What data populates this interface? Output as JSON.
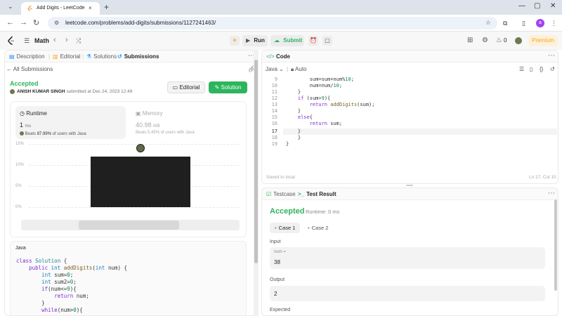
{
  "browser": {
    "tab_title": "Add Digits - LeetCode",
    "tab_close": "×",
    "new_tab": "+",
    "url": "leetcode.com/problems/add-digits/submissions/1127241463/"
  },
  "header": {
    "problem_list": "Math",
    "run_label": "Run",
    "submit_label": "Submit",
    "coins": "0",
    "premium_label": "Premium"
  },
  "left_tabs": [
    {
      "label": "Description"
    },
    {
      "label": "Editorial"
    },
    {
      "label": "Solutions"
    },
    {
      "label": "Submissions"
    }
  ],
  "submission": {
    "back_label": "All Submissions",
    "status": "Accepted",
    "author": "ANISH KUMAR SINGH",
    "submitted_text": "submitted at Dec 24, 2023 12:49",
    "editorial_btn": "Editorial",
    "solution_btn": "Solution"
  },
  "runtime": {
    "label": "Runtime",
    "value": "1",
    "unit": "ms",
    "beats_prefix": "Beats ",
    "beats_pct": "87.99%",
    "beats_suffix": " of users with Java"
  },
  "memory": {
    "label": "Memory",
    "value": "40.98",
    "unit": "MB",
    "beats_prefix": "Beats ",
    "beats_pct": "5.45%",
    "beats_suffix": " of users with Java"
  },
  "chart_data": {
    "type": "bar",
    "ytick_labels": [
      "15%",
      "10%",
      "5%",
      "0%"
    ],
    "ylim": [
      0,
      15
    ],
    "values": [
      12
    ]
  },
  "submitted_code": {
    "language": "Java",
    "lines": [
      "class Solution {",
      "    public int addDigits(int num) {",
      "        int sum=0;",
      "        int sum2=0;",
      "        if(num<=9){",
      "            return num;",
      "        }",
      "        while(num>0){"
    ]
  },
  "code_panel": {
    "title": "Code",
    "language": "Java",
    "mode": "Auto",
    "line_numbers": [
      "9",
      "10",
      "11",
      "12",
      "13",
      "14",
      "15",
      "16",
      "17",
      "18",
      "19"
    ],
    "lines": [
      "        sum=sum+num%10;",
      "        num=num/10;",
      "    }",
      "    if (sum>9){",
      "        return addDigits(sum);",
      "    }",
      "    else{",
      "        return sum;",
      "    }",
      "    }",
      "}"
    ],
    "saved_text": "Saved to local",
    "cursor_pos": "Ln 17, Col 10"
  },
  "test_panel": {
    "tab_testcase": "Testcase",
    "tab_result": "Test Result",
    "status": "Accepted",
    "runtime_text": "Runtime: 0 ms",
    "case1": "Case 1",
    "case2": "Case 2",
    "input_label": "Input",
    "input_name": "num =",
    "input_value": "38",
    "output_label": "Output",
    "output_value": "2",
    "expected_label": "Expected"
  },
  "colors": {
    "accepted_green": "#2db55d",
    "leetcode_orange": "#ffa116",
    "premium_bg": "#fdf1dc"
  }
}
